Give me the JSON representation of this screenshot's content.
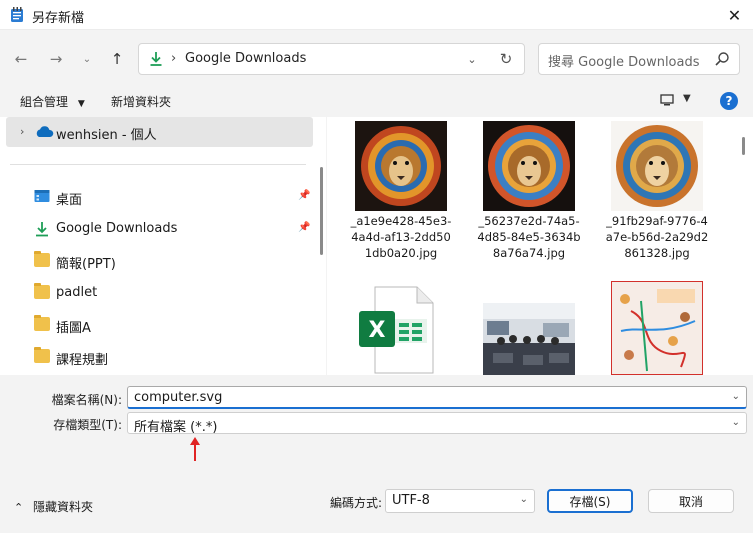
{
  "window": {
    "title": "另存新檔"
  },
  "nav": {
    "address": "Google Downloads",
    "search_placeholder": "搜尋 Google Downloads"
  },
  "toolbar": {
    "organize": "組合管理",
    "new_folder": "新增資料夾",
    "help": "?"
  },
  "sidebar": {
    "onedrive": "wenhsien - 個人",
    "items": [
      {
        "label": "桌面",
        "icon": "desktop-icon",
        "pinned": true
      },
      {
        "label": "Google Downloads",
        "icon": "download-icon",
        "pinned": true
      },
      {
        "label": "簡報(PPT)",
        "icon": "folder-icon",
        "pinned": false
      },
      {
        "label": "padlet",
        "icon": "folder-icon",
        "pinned": false
      },
      {
        "label": "插圖A",
        "icon": "folder-icon",
        "pinned": false
      },
      {
        "label": "課程規劃",
        "icon": "folder-icon",
        "pinned": false
      }
    ]
  },
  "files": [
    {
      "name": "_a1e9e428-45e3-4a4d-af13-2dd501db0a20.jpg",
      "kind": "lion-dark"
    },
    {
      "name": "_56237e2d-74a5-4d85-84e5-3634b8a76a74.jpg",
      "kind": "lion-dark"
    },
    {
      "name": "_91fb29af-9776-4a7e-b56d-2a29d2861328.jpg",
      "kind": "lion-light"
    },
    {
      "name": "",
      "kind": "excel"
    },
    {
      "name": "",
      "kind": "photo"
    },
    {
      "name": "",
      "kind": "map"
    }
  ],
  "form": {
    "filename_label": "檔案名稱(N):",
    "filename_value": "computer.svg",
    "filetype_label": "存檔類型(T):",
    "filetype_value": "所有檔案 (*.*)",
    "hide_folders": "隱藏資料夾",
    "encoding_label": "編碼方式:",
    "encoding_value": "UTF-8",
    "save": "存檔(S)",
    "cancel": "取消"
  },
  "colors": {
    "accent": "#1a6fd1",
    "download_green": "#1e9e57",
    "annotation_red": "#e02424"
  }
}
